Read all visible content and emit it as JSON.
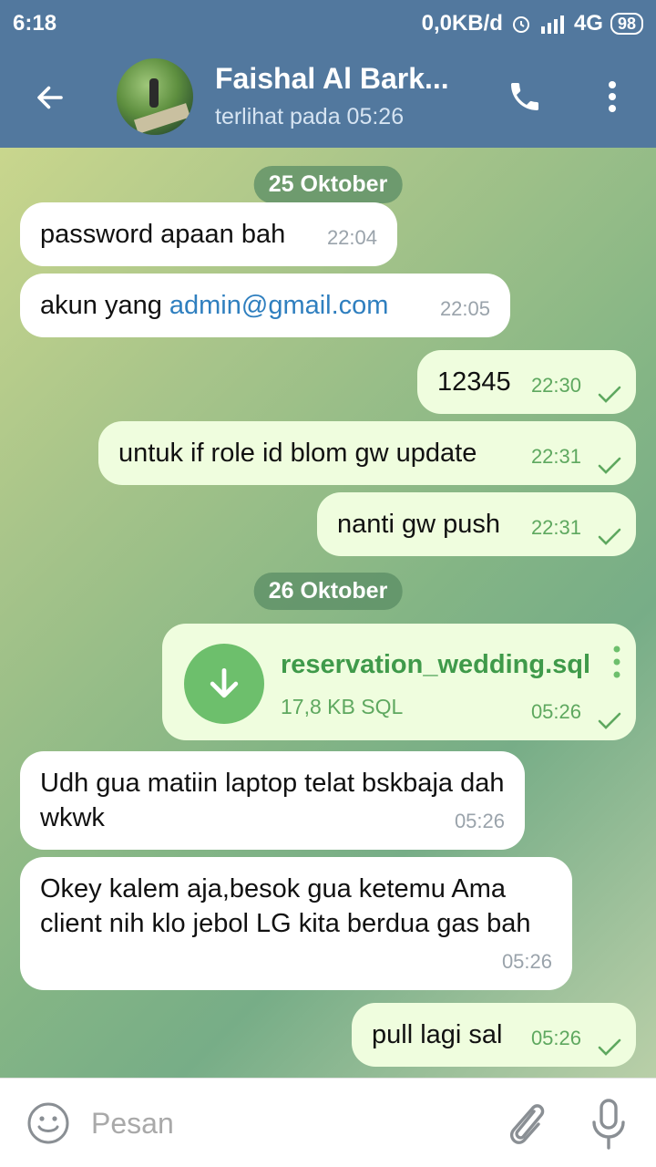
{
  "status_bar": {
    "time": "6:18",
    "data_rate": "0,0KB/d",
    "network": "4G",
    "battery": "98"
  },
  "header": {
    "contact_name": "Faishal Al Bark...",
    "last_seen": "terlihat pada  05:26",
    "icons": [
      "back-arrow-icon",
      "phone-icon",
      "more-vertical-icon"
    ]
  },
  "dates": [
    "25 Oktober",
    "26 Oktober"
  ],
  "messages": [
    {
      "dir": "in",
      "text": "password apaan bah",
      "time": "22:04"
    },
    {
      "dir": "in",
      "text_prefix": "akun yang ",
      "link": "admin@gmail.com",
      "time": "22:05"
    },
    {
      "dir": "out",
      "text": "12345",
      "time": "22:30",
      "status": "sent"
    },
    {
      "dir": "out",
      "text": "untuk if role id blom gw update",
      "time": "22:31",
      "status": "sent"
    },
    {
      "dir": "out",
      "text": "nanti gw push",
      "time": "22:31",
      "status": "sent"
    },
    {
      "dir": "out",
      "file_name": "reservation_wedding.sql",
      "file_meta": "17,8 KB SQL",
      "time": "05:26",
      "status": "sent"
    },
    {
      "dir": "in",
      "text": "Udh gua matiin laptop telat bskbaja dah wkwk",
      "time": "05:26"
    },
    {
      "dir": "in",
      "text": "Okey kalem aja,besok gua ketemu Ama client nih klo jebol LG kita berdua gas bah",
      "time": "05:26"
    },
    {
      "dir": "out",
      "text": "pull lagi sal",
      "time": "05:26",
      "status": "sent"
    }
  ],
  "input": {
    "placeholder": "Pesan"
  },
  "colors": {
    "header": "#52789e",
    "bubble_in": "#ffffff",
    "bubble_out": "#effdde",
    "accent_green": "#5ea85f",
    "link": "#2f7fbf"
  }
}
